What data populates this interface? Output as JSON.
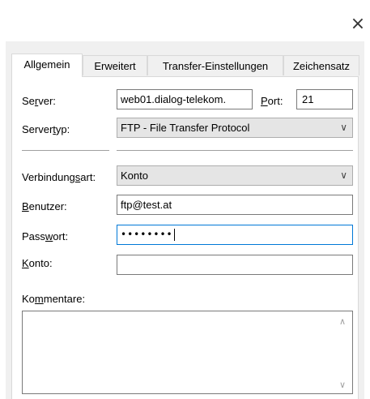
{
  "window": {
    "close_glyph": "×"
  },
  "tabs": [
    {
      "label": "Allgemein",
      "active": true
    },
    {
      "label": "Erweitert",
      "active": false
    },
    {
      "label": "Transfer-Einstellungen",
      "active": false
    },
    {
      "label": "Zeichensatz",
      "active": false
    }
  ],
  "form": {
    "server": {
      "label_pre": "Se",
      "label_key": "r",
      "label_post": "ver:",
      "value": "web01.dialog-telekom."
    },
    "port": {
      "label_key": "P",
      "label_post": "ort:",
      "value": "21"
    },
    "servertyp": {
      "label_pre": "Server",
      "label_key": "t",
      "label_post": "yp:",
      "value": "FTP - File Transfer Protocol"
    },
    "verbindungsart": {
      "label_pre": "Verbindung",
      "label_key": "s",
      "label_post": "art:",
      "value": "Konto"
    },
    "benutzer": {
      "label_key": "B",
      "label_post": "enutzer:",
      "value": "ftp@test.at"
    },
    "passwort": {
      "label_pre": "Pass",
      "label_key": "w",
      "label_post": "ort:",
      "value": "••••••••"
    },
    "konto": {
      "label_key": "K",
      "label_post": "onto:",
      "value": ""
    },
    "kommentare": {
      "label_pre": "Ko",
      "label_key": "m",
      "label_post": "mentare:",
      "value": ""
    }
  },
  "icons": {
    "close": "close-icon",
    "dropdown": "chevron-down-icon",
    "scroll_up": "scroll-up-icon",
    "scroll_down": "scroll-down-icon"
  }
}
